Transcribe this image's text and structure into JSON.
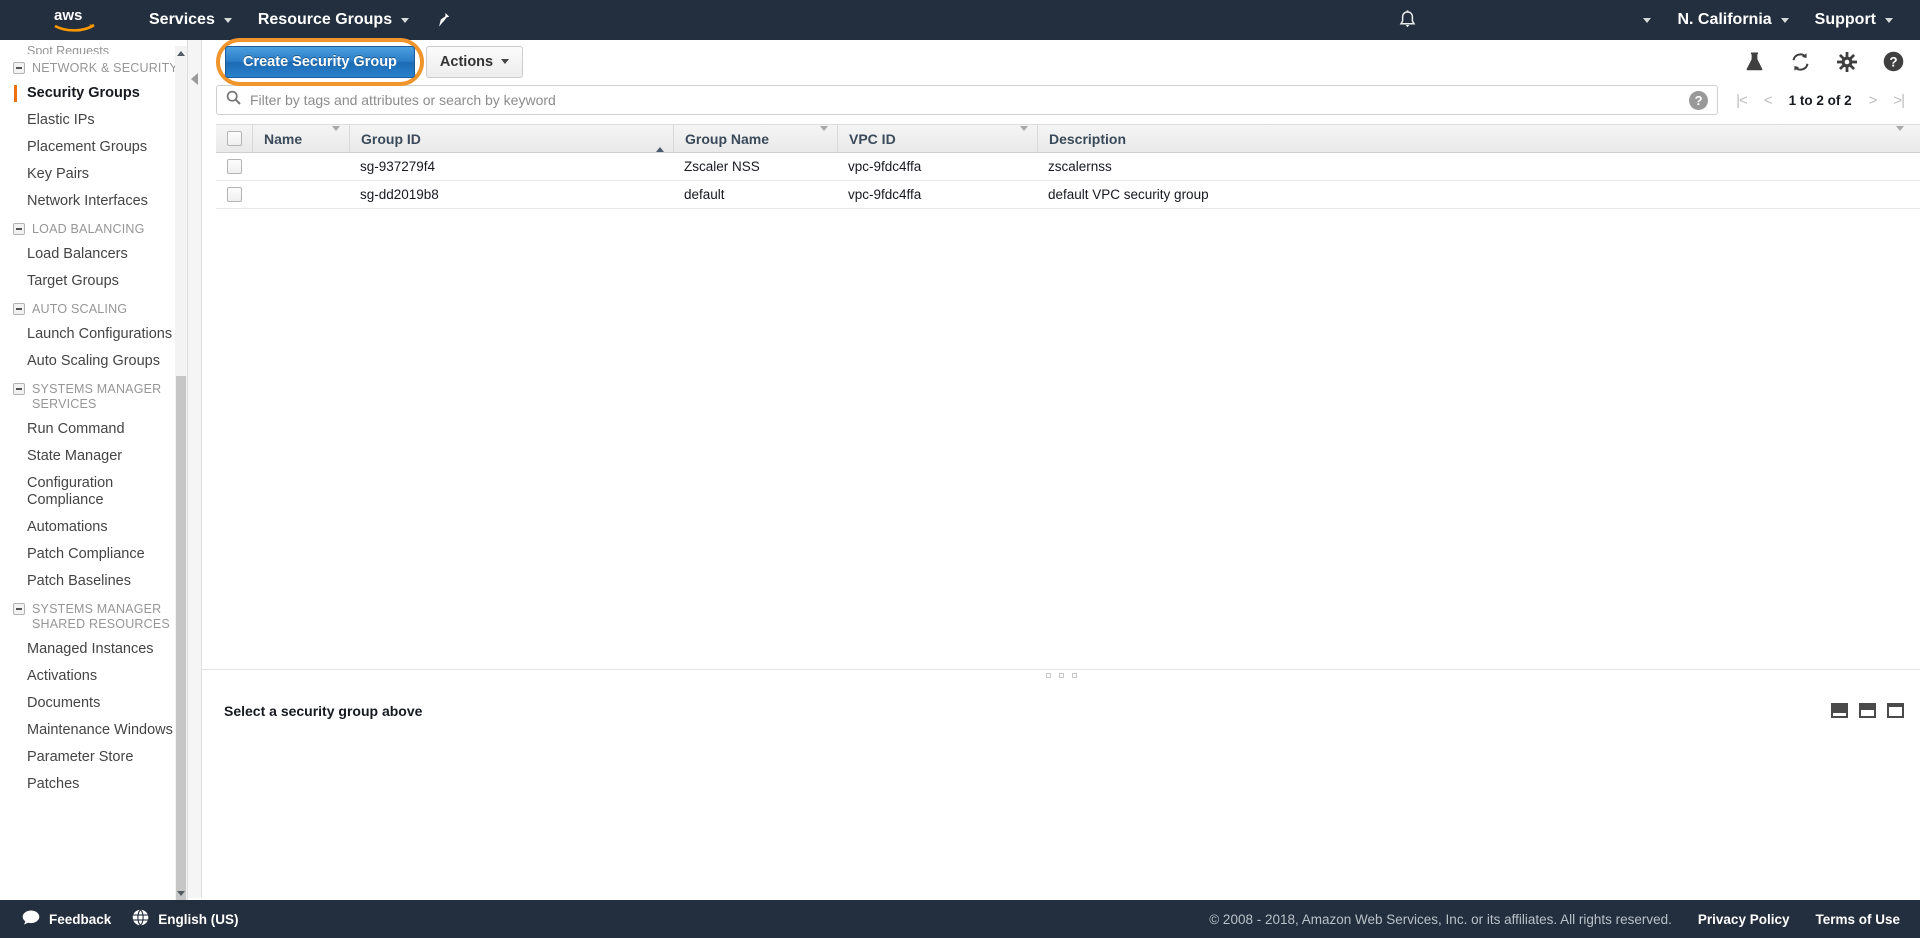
{
  "topnav": {
    "logo": "aws-logo",
    "services_label": "Services",
    "resource_groups_label": "Resource Groups",
    "pin_icon": "pin-icon",
    "bell_icon": "bell-icon",
    "account_caret": "chevron-down-icon",
    "region_label": "N. California",
    "support_label": "Support"
  },
  "sidebar": {
    "partial_top": "Spot Requests",
    "groups": [
      {
        "label": "NETWORK & SECURITY",
        "items": [
          {
            "label": "Security Groups",
            "active": true
          },
          {
            "label": "Elastic IPs",
            "active": false
          },
          {
            "label": "Placement Groups",
            "active": false
          },
          {
            "label": "Key Pairs",
            "active": false
          },
          {
            "label": "Network Interfaces",
            "active": false
          }
        ]
      },
      {
        "label": "LOAD BALANCING",
        "items": [
          {
            "label": "Load Balancers",
            "active": false
          },
          {
            "label": "Target Groups",
            "active": false
          }
        ]
      },
      {
        "label": "AUTO SCALING",
        "items": [
          {
            "label": "Launch Configurations",
            "active": false
          },
          {
            "label": "Auto Scaling Groups",
            "active": false
          }
        ]
      },
      {
        "label": "SYSTEMS MANAGER SERVICES",
        "items": [
          {
            "label": "Run Command",
            "active": false
          },
          {
            "label": "State Manager",
            "active": false
          },
          {
            "label": "Configuration Compliance",
            "active": false
          },
          {
            "label": "Automations",
            "active": false
          },
          {
            "label": "Patch Compliance",
            "active": false
          },
          {
            "label": "Patch Baselines",
            "active": false
          }
        ]
      },
      {
        "label": "SYSTEMS MANAGER SHARED RESOURCES",
        "items": [
          {
            "label": "Managed Instances",
            "active": false
          },
          {
            "label": "Activations",
            "active": false
          },
          {
            "label": "Documents",
            "active": false
          },
          {
            "label": "Maintenance Windows",
            "active": false
          },
          {
            "label": "Parameter Store",
            "active": false
          },
          {
            "label": "Patches",
            "active": false
          }
        ]
      }
    ]
  },
  "toolbar": {
    "create_label": "Create Security Group",
    "actions_label": "Actions",
    "highlight_color": "#f0942c",
    "icons": [
      "flask-icon",
      "refresh-icon",
      "gear-icon",
      "help-icon"
    ]
  },
  "filter": {
    "placeholder": "Filter by tags and attributes or search by keyword",
    "value": "",
    "help_glyph": "?",
    "search_icon": "search-icon"
  },
  "pager": {
    "first": "|<",
    "prev": "<",
    "count": "1 to 2 of 2",
    "next": ">",
    "last": ">|"
  },
  "table": {
    "columns": [
      {
        "label": "Name",
        "sort": "none"
      },
      {
        "label": "Group ID",
        "sort": "asc"
      },
      {
        "label": "Group Name",
        "sort": "none"
      },
      {
        "label": "VPC ID",
        "sort": "none"
      },
      {
        "label": "Description",
        "sort": "none"
      }
    ],
    "rows": [
      {
        "name": "",
        "group_id": "sg-937279f4",
        "group_name": "Zscaler NSS",
        "vpc_id": "vpc-9fdc4ffa",
        "description": "zscalernss"
      },
      {
        "name": "",
        "group_id": "sg-dd2019b8",
        "group_name": "default",
        "vpc_id": "vpc-9fdc4ffa",
        "description": "default VPC security group"
      }
    ]
  },
  "bottom_panel": {
    "title": "Select a security group above",
    "layout_icons": [
      "panel-small-icon",
      "panel-medium-icon",
      "panel-large-icon"
    ]
  },
  "footer": {
    "feedback_label": "Feedback",
    "feedback_icon": "speech-bubble-icon",
    "language_label": "English (US)",
    "globe_icon": "globe-icon",
    "copyright": "© 2008 - 2018, Amazon Web Services, Inc. or its affiliates. All rights reserved.",
    "privacy_label": "Privacy Policy",
    "terms_label": "Terms of Use"
  }
}
